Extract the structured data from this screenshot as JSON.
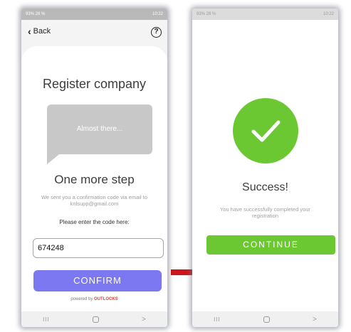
{
  "left_screen": {
    "status_left": "93% 28 %",
    "status_right": "10:22",
    "back_label": "Back",
    "help_glyph": "?",
    "title": "Register company",
    "bubble_text": "Almost there...",
    "step_title": "One more step",
    "info_text": "We sent you a confirmation code via email to knlsupp@gmail.com",
    "prompt": "Please enter the code here:",
    "code_value": "674248",
    "confirm_label": "CONFIRM",
    "powered_prefix": "powered by",
    "powered_brand": "OUTLOCKS"
  },
  "right_screen": {
    "status_left": "93% 28 %",
    "status_right": "10:22",
    "success_title": "Success!",
    "success_text": "You have successfully completed your registration",
    "continue_label": "CONTINUE"
  },
  "nav": {
    "recent_glyph": "III",
    "back_glyph": ">"
  },
  "colors": {
    "confirm": "#7b78f2",
    "success": "#6cc832",
    "arrow": "#d0141c",
    "brand": "#e0403a"
  },
  "icons": [
    "back-chevron-icon",
    "help-icon",
    "checkmark-icon",
    "arrow-right-icon",
    "nav-recent-icon",
    "nav-home-icon",
    "nav-back-icon"
  ]
}
